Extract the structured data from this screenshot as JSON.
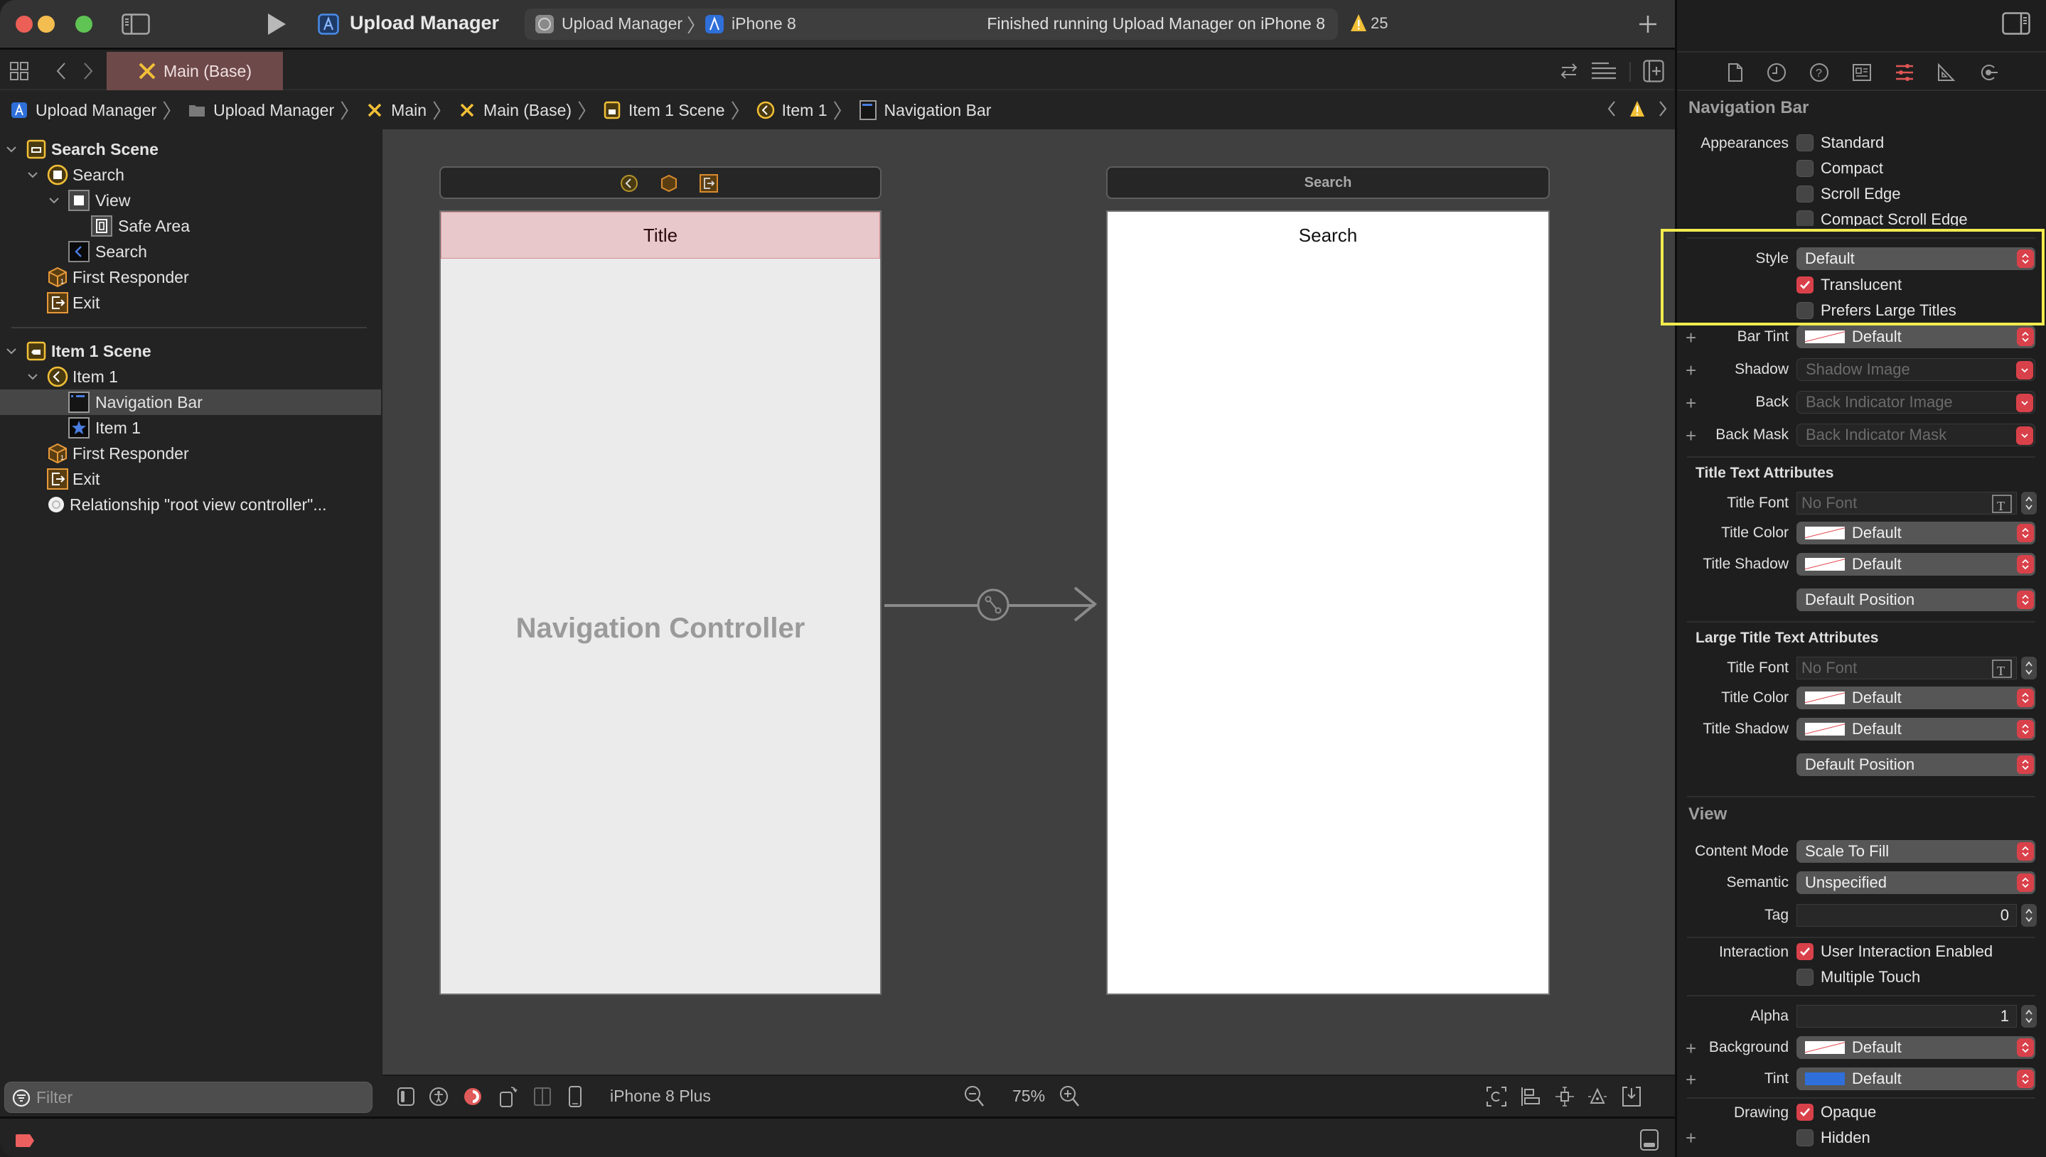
{
  "toolbar": {
    "scheme_name": "Upload Manager",
    "activity_target": "Upload Manager",
    "activity_device": "iPhone 8",
    "activity_status": "Finished running Upload Manager on iPhone 8",
    "warning_count": "25",
    "icons": [
      "sidebar-toggle-icon",
      "run-icon",
      "app-icon",
      "warning-icon",
      "plus-icon",
      "inspector-toggle-icon"
    ]
  },
  "tabs": [
    {
      "label": "Main (Base)",
      "icon": "storyboard-icon",
      "active": true
    }
  ],
  "breadcrumb": [
    {
      "label": "Upload Manager",
      "icon": "app-icon"
    },
    {
      "label": "Upload Manager",
      "icon": "folder-icon"
    },
    {
      "label": "Main",
      "icon": "storyboard-icon"
    },
    {
      "label": "Main (Base)",
      "icon": "storyboard-icon"
    },
    {
      "label": "Item 1 Scene",
      "icon": "scene-icon"
    },
    {
      "label": "Item 1",
      "icon": "navigation-controller-icon"
    },
    {
      "label": "Navigation Bar",
      "icon": "navigation-bar-icon"
    }
  ],
  "navigator": {
    "items": [
      {
        "label": "Search Scene",
        "level": 0,
        "expanded": true,
        "bold": true,
        "icon": "scene-icon"
      },
      {
        "label": "Search",
        "level": 1,
        "expanded": true,
        "icon": "view-controller-icon"
      },
      {
        "label": "View",
        "level": 2,
        "expanded": true,
        "icon": "view-icon"
      },
      {
        "label": "Safe Area",
        "level": 3,
        "icon": "safe-area-icon"
      },
      {
        "label": "Search",
        "level": 2,
        "icon": "navigation-item-icon"
      },
      {
        "label": "First Responder",
        "level": 1,
        "icon": "first-responder-icon"
      },
      {
        "label": "Exit",
        "level": 1,
        "icon": "exit-icon"
      },
      {
        "label": "Item 1 Scene",
        "level": 0,
        "expanded": true,
        "bold": true,
        "icon": "scene-icon"
      },
      {
        "label": "Item 1",
        "level": 1,
        "expanded": true,
        "icon": "navigation-controller-icon"
      },
      {
        "label": "Navigation Bar",
        "level": 2,
        "selected": true,
        "icon": "navigation-bar-icon"
      },
      {
        "label": "Item 1",
        "level": 2,
        "icon": "tab-bar-item-icon"
      },
      {
        "label": "First Responder",
        "level": 1,
        "icon": "first-responder-icon"
      },
      {
        "label": "Exit",
        "level": 1,
        "icon": "exit-icon"
      },
      {
        "label": "Relationship \"root view controller\"...",
        "level": 1,
        "icon": "relationship-icon"
      }
    ],
    "filter_placeholder": "Filter"
  },
  "canvas": {
    "nav_controller": {
      "nav_bar_title": "Title",
      "label": "Navigation Controller"
    },
    "search_controller": {
      "scene_bar_title": "Search",
      "nav_title": "Search"
    },
    "device": "iPhone 8 Plus",
    "zoom": "75%"
  },
  "inspector": {
    "section_title": "Navigation Bar",
    "appearances_label": "Appearances",
    "appearances": [
      {
        "label": "Standard",
        "checked": false
      },
      {
        "label": "Compact",
        "checked": false
      },
      {
        "label": "Scroll Edge",
        "checked": false
      },
      {
        "label": "Compact Scroll Edge",
        "checked": false
      }
    ],
    "style_label": "Style",
    "style_value": "Default",
    "translucent": {
      "label": "Translucent",
      "checked": true
    },
    "prefers_large_titles": {
      "label": "Prefers Large Titles",
      "checked": false
    },
    "bar_tint": {
      "label": "Bar Tint",
      "value": "Default"
    },
    "shadow": {
      "label": "Shadow",
      "placeholder": "Shadow Image"
    },
    "back": {
      "label": "Back",
      "placeholder": "Back Indicator Image"
    },
    "back_mask": {
      "label": "Back Mask",
      "placeholder": "Back Indicator Mask"
    },
    "title_text_attributes": {
      "title": "Title Text Attributes",
      "font_label": "Title Font",
      "font_placeholder": "No Font",
      "color_label": "Title Color",
      "color_value": "Default",
      "shadow_label": "Title Shadow",
      "shadow_value": "Default",
      "position_value": "Default Position"
    },
    "large_title_text_attributes": {
      "title": "Large Title Text Attributes",
      "font_label": "Title Font",
      "font_placeholder": "No Font",
      "color_label": "Title Color",
      "color_value": "Default",
      "shadow_label": "Title Shadow",
      "shadow_value": "Default",
      "position_value": "Default Position"
    },
    "view": {
      "title": "View",
      "content_mode_label": "Content Mode",
      "content_mode_value": "Scale To Fill",
      "semantic_label": "Semantic",
      "semantic_value": "Unspecified",
      "tag_label": "Tag",
      "tag_value": "0",
      "interaction_label": "Interaction",
      "user_interaction": {
        "label": "User Interaction Enabled",
        "checked": true
      },
      "multiple_touch": {
        "label": "Multiple Touch",
        "checked": false
      },
      "alpha_label": "Alpha",
      "alpha_value": "1",
      "background_label": "Background",
      "background_value": "Default",
      "tint_label": "Tint",
      "tint_value": "Default",
      "tint_color": "#2f6fd9",
      "drawing_label": "Drawing",
      "opaque": {
        "label": "Opaque",
        "checked": true
      },
      "hidden": {
        "label": "Hidden",
        "checked": false
      }
    }
  },
  "colors": {
    "accent": "#d9414a",
    "highlight": "#f1ec4e",
    "selected_tab": "#6e4949",
    "nav_bar_selection": "#e8c8ca"
  }
}
